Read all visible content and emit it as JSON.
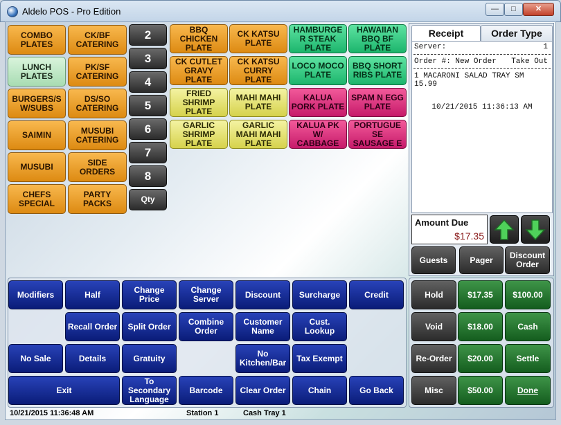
{
  "window": {
    "title": "Aldelo POS - Pro Edition",
    "min_symbol": "—",
    "max_symbol": "□",
    "close_symbol": "✕"
  },
  "categories": [
    {
      "label": "COMBO PLATES",
      "color": "orange"
    },
    {
      "label": "CK/BF CATERING",
      "color": "orange"
    },
    {
      "label": "LUNCH PLATES",
      "color": "lightgreen"
    },
    {
      "label": "PK/SF CATERING",
      "color": "orange"
    },
    {
      "label": "BURGERS/S W/SUBS",
      "color": "orange"
    },
    {
      "label": "DS/SO CATERING",
      "color": "orange"
    },
    {
      "label": "SAIMIN",
      "color": "orange"
    },
    {
      "label": "MUSUBI CATERING",
      "color": "orange"
    },
    {
      "label": "MUSUBI",
      "color": "orange"
    },
    {
      "label": "SIDE ORDERS",
      "color": "orange"
    },
    {
      "label": "CHEFS SPECIAL",
      "color": "orange"
    },
    {
      "label": "PARTY PACKS",
      "color": "orange"
    }
  ],
  "qty_buttons": [
    "2",
    "3",
    "4",
    "5",
    "6",
    "7",
    "8",
    "Qty"
  ],
  "menu_items": [
    {
      "label": "BBQ CHICKEN PLATE",
      "color": "orange"
    },
    {
      "label": "CK KATSU PLATE",
      "color": "orange"
    },
    {
      "label": "HAMBURGE R STEAK PLATE",
      "color": "green"
    },
    {
      "label": "HAWAIIAN BBQ BF PLATE",
      "color": "green"
    },
    {
      "label": "CK CUTLET GRAVY PLATE",
      "color": "orange"
    },
    {
      "label": "CK KATSU CURRY PLATE",
      "color": "orange"
    },
    {
      "label": "LOCO MOCO PLATE",
      "color": "green"
    },
    {
      "label": "BBQ SHORT RIBS PLATE",
      "color": "green"
    },
    {
      "label": "FRIED SHRIMP PLATE",
      "color": "yellow"
    },
    {
      "label": "MAHI MAHI PLATE",
      "color": "yellow"
    },
    {
      "label": "KALUA PORK PLATE",
      "color": "magenta"
    },
    {
      "label": "SPAM N EGG PLATE",
      "color": "magenta"
    },
    {
      "label": "GARLIC SHRIMP PLATE",
      "color": "yellow"
    },
    {
      "label": "GARLIC MAHI MAHI PLATE",
      "color": "yellow"
    },
    {
      "label": "KALUA PK W/ CABBAGE",
      "color": "magenta"
    },
    {
      "label": "PORTUGUE SE SAUSAGE E",
      "color": "magenta"
    }
  ],
  "functions": {
    "row1": [
      "Modifiers",
      "Half",
      "Change Price",
      "Change Server",
      "Discount",
      "Surcharge",
      "Credit"
    ],
    "row2": [
      "Recall Order",
      "Split Order",
      "Combine Order",
      "Customer Name",
      "Cust. Lookup"
    ],
    "row3": [
      "No Sale",
      "Details",
      "Gratuity",
      "No Kitchen/Bar",
      "Tax Exempt"
    ],
    "row4": [
      "Exit",
      "To Secondary Language",
      "Barcode",
      "Clear Order",
      "Chain",
      "Go Back"
    ]
  },
  "receipt": {
    "tab_receipt": "Receipt",
    "tab_order_type": "Order Type",
    "server_label": "Server:",
    "server_value": "1",
    "order_label": "Order #: New Order",
    "order_type": "Take Out",
    "item_line1": "1 MACARONI SALAD TRAY SM",
    "item_line2": "15.99",
    "timestamp": "10/21/2015 11:36:13 AM"
  },
  "amount_due": {
    "label": "Amount Due",
    "value": "$17.35"
  },
  "order_buttons": [
    "Guests",
    "Pager",
    "Discount Order"
  ],
  "payment": {
    "col1": [
      "Hold",
      "Void",
      "Re-Order",
      "Misc"
    ],
    "col2": [
      "$17.35",
      "$18.00",
      "$20.00",
      "$50.00"
    ],
    "col3": [
      "$100.00",
      "Cash",
      "Settle",
      "Done"
    ]
  },
  "status": {
    "datetime": "10/21/2015 11:36:48 AM",
    "station": "Station 1",
    "cash_tray": "Cash Tray 1"
  }
}
